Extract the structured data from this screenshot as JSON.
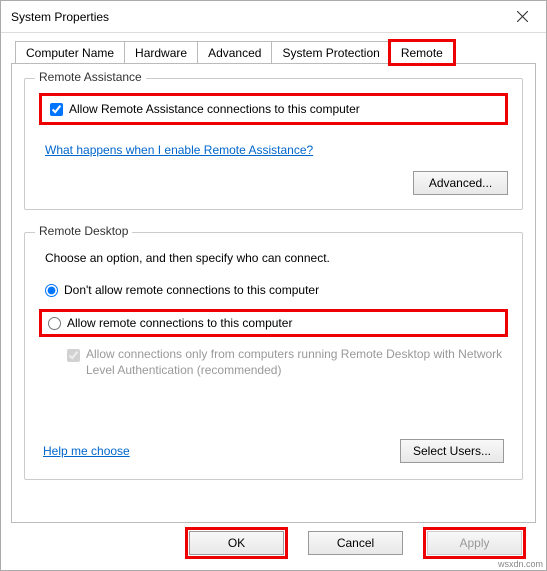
{
  "window": {
    "title": "System Properties"
  },
  "tabs": {
    "computer_name": "Computer Name",
    "hardware": "Hardware",
    "advanced": "Advanced",
    "system_protection": "System Protection",
    "remote": "Remote"
  },
  "remote_assistance": {
    "legend": "Remote Assistance",
    "allow_label": "Allow Remote Assistance connections to this computer",
    "help_link": "What happens when I enable Remote Assistance?",
    "advanced_button": "Advanced..."
  },
  "remote_desktop": {
    "legend": "Remote Desktop",
    "instruction": "Choose an option, and then specify who can connect.",
    "option_dont_allow": "Don't allow remote connections to this computer",
    "option_allow": "Allow remote connections to this computer",
    "nla_label": "Allow connections only from computers running Remote Desktop with Network Level Authentication (recommended)",
    "help_link": "Help me choose",
    "select_users_button": "Select Users..."
  },
  "buttons": {
    "ok": "OK",
    "cancel": "Cancel",
    "apply": "Apply"
  },
  "watermark": "wsxdn.com"
}
